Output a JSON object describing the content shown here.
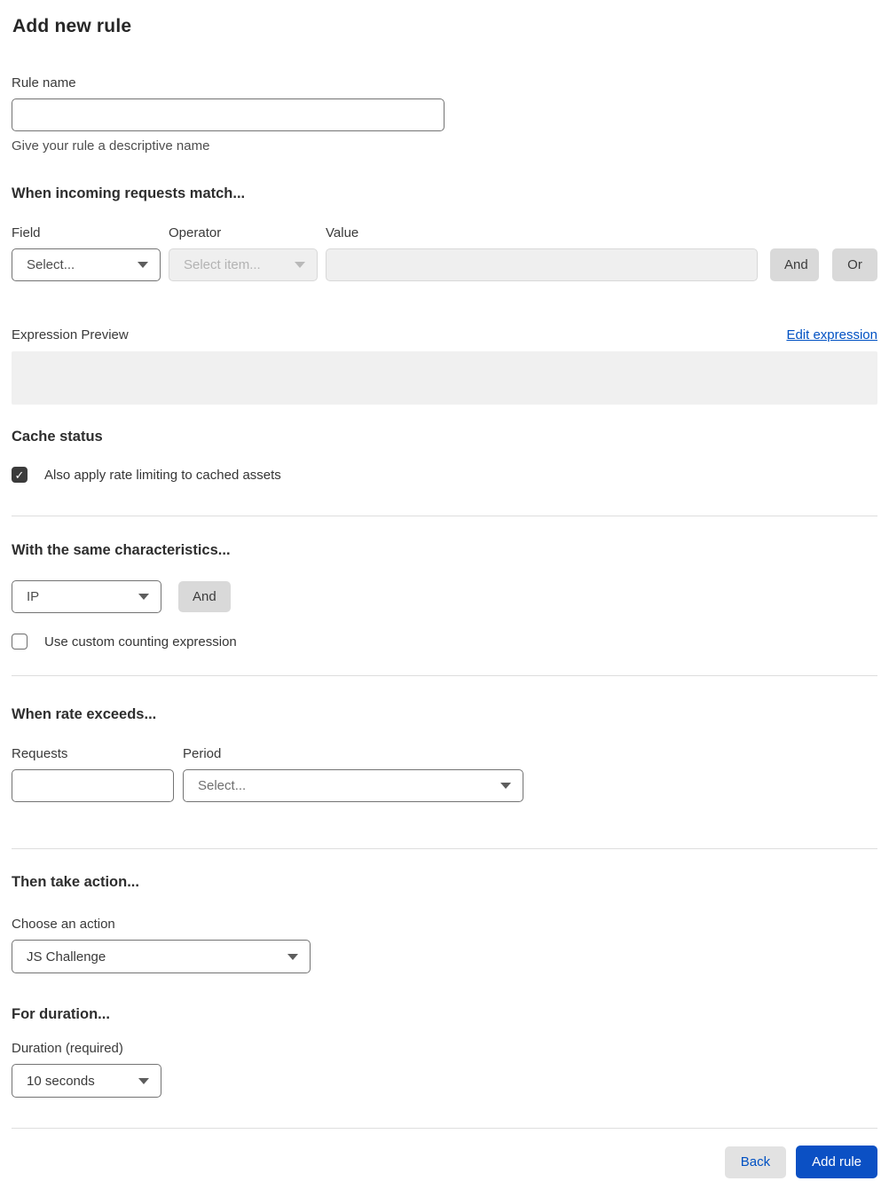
{
  "page": {
    "title": "Add new rule"
  },
  "rule_name": {
    "label": "Rule name",
    "value": "",
    "helper": "Give your rule a descriptive name"
  },
  "match_section": {
    "heading": "When incoming requests match...",
    "field": {
      "label": "Field",
      "selected": "Select..."
    },
    "operator": {
      "label": "Operator",
      "selected": "Select item...",
      "disabled": true
    },
    "value": {
      "label": "Value",
      "value": "",
      "disabled": true
    },
    "and_button": "And",
    "or_button": "Or"
  },
  "expression": {
    "label": "Expression Preview",
    "edit_link": "Edit expression",
    "preview_text": ""
  },
  "cache_status": {
    "heading": "Cache status",
    "checkbox_label": "Also apply rate limiting to cached assets",
    "checked": true,
    "check_glyph": "✓"
  },
  "characteristics": {
    "heading": "With the same characteristics...",
    "select_selected": "IP",
    "and_button": "And",
    "checkbox_label": "Use custom counting expression",
    "checked": false
  },
  "rate_section": {
    "heading": "When rate exceeds...",
    "requests": {
      "label": "Requests",
      "value": ""
    },
    "period": {
      "label": "Period",
      "selected": "Select..."
    }
  },
  "action_section": {
    "heading": "Then take action...",
    "label": "Choose an action",
    "selected": "JS Challenge"
  },
  "duration_section": {
    "heading": "For duration...",
    "label": "Duration (required)",
    "selected": "10 seconds"
  },
  "footer": {
    "back_button": "Back",
    "submit_button": "Add rule"
  },
  "colors": {
    "accent_blue": "#0051c3",
    "primary_button_bg": "#0b50c4",
    "gray_button_bg": "#d9d9d9",
    "disabled_bg": "#efefef",
    "preview_box_bg": "#f0f0f0",
    "divider": "#dedede",
    "checkbox_checked_bg": "#3b3b3b"
  }
}
